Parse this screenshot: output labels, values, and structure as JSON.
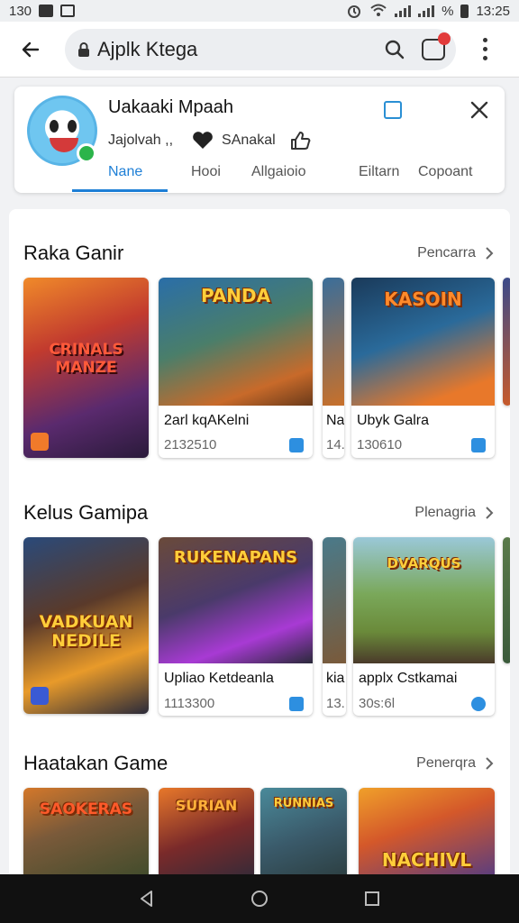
{
  "status_bar": {
    "left_text": "130",
    "time": "13:25",
    "percent": "%"
  },
  "browser": {
    "url_text": "Ajplk Ktega"
  },
  "app_card": {
    "name": "Uakaaki Mpaah",
    "sub_left": "Jajolvah ,,",
    "sub_right": "SAnakal",
    "tabs": [
      "Nane",
      "Hooi",
      "Allgaioio",
      "Eiltarn",
      "Copoant"
    ],
    "active_tab": 0
  },
  "sections": [
    {
      "title": "Raka Ganir",
      "more": "Pencarra",
      "items": [
        {
          "title": "",
          "subtitle": "",
          "art_text": "CRINALS\nMANZE"
        },
        {
          "title": "2arl kqAKelni",
          "subtitle": "2132510",
          "art_text": "PANDA"
        },
        {
          "title": "Na",
          "subtitle": "14.",
          "art_text": ""
        },
        {
          "title": "Ubyk Galra",
          "subtitle": "130610",
          "art_text": "KASOIN"
        },
        {
          "title": "",
          "subtitle": "",
          "art_text": ""
        }
      ]
    },
    {
      "title": "Kelus Gamipa",
      "more": "Plenagria",
      "items": [
        {
          "title": "",
          "subtitle": "",
          "art_text": "VADKUAN\nNEDILE"
        },
        {
          "title": "Upliao Ketdeanla",
          "subtitle": "1113300",
          "art_text": "RUKENAPANS"
        },
        {
          "title": "kia",
          "subtitle": "13.",
          "art_text": ""
        },
        {
          "title": "applx Cstkamai",
          "subtitle": "30s:6l",
          "art_text": "DVARQUS"
        },
        {
          "title": "",
          "subtitle": "",
          "art_text": ""
        }
      ]
    },
    {
      "title": "Haatakan Game",
      "more": "Penerqra",
      "items": [
        {
          "title": "",
          "subtitle": "",
          "art_text": "SAOKERAS"
        },
        {
          "title": "",
          "subtitle": "",
          "art_text": "SURIAN"
        },
        {
          "title": "",
          "subtitle": "",
          "art_text": "RUNNIAS"
        },
        {
          "title": "",
          "subtitle": "",
          "art_text": "NACHIVL"
        }
      ]
    }
  ],
  "icons": {
    "back": "arrow-left-icon",
    "lock": "lock-icon",
    "search": "search-icon",
    "tabs": "tabs-icon",
    "menu": "more-vert-icon",
    "close": "close-icon",
    "bookmark": "bookmark-icon",
    "nav_back": "triangle-back-icon",
    "nav_home": "circle-home-icon",
    "nav_recent": "square-recent-icon"
  },
  "colors": {
    "accent": "#1e7fd6",
    "badge": "#e23b3b",
    "nav": "#111111"
  }
}
